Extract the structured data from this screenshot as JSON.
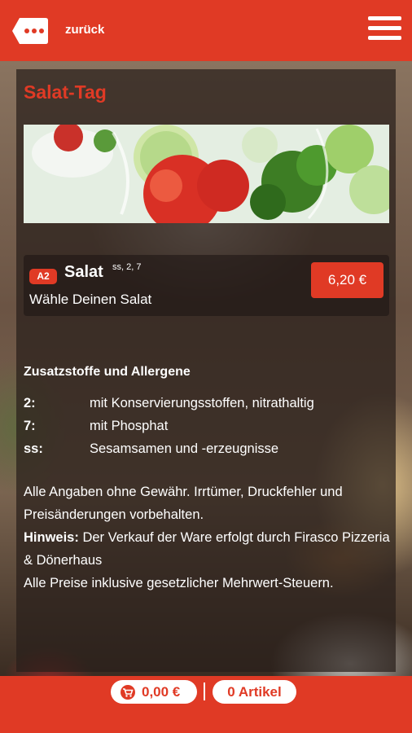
{
  "header": {
    "back_label": "zurück",
    "back_icon": "chat-bubble-back-icon",
    "menu_icon": "hamburger-menu-icon"
  },
  "section": {
    "title": "Salat-Tag"
  },
  "product": {
    "badge": "A2",
    "name": "Salat",
    "additives": "ss, 2, 7",
    "description": "Wähle Deinen Salat",
    "price": "6,20 €"
  },
  "allergens": {
    "title": "Zusatzstoffe und Allergene",
    "items": [
      {
        "code": "2:",
        "text": "mit Konservierungsstoffen, nitrathaltig"
      },
      {
        "code": "7:",
        "text": "mit Phosphat"
      },
      {
        "code": "ss:",
        "text": "Sesamsamen und -erzeugnisse"
      }
    ]
  },
  "notes": {
    "disclaimer": "Alle Angaben ohne Gewähr. Irrtümer, Druckfehler und Preisänderungen vorbehalten.",
    "hint_label": "Hinweis:",
    "hint_text": " Der Verkauf der Ware erfolgt durch Firasco Pizzeria & Dönerhaus",
    "tax": "Alle Preise inklusive gesetzlicher Mehrwert-Steuern."
  },
  "footer": {
    "cart_total": "0,00 €",
    "cart_icon": "shopping-cart-icon",
    "items_count": "0 Artikel"
  },
  "colors": {
    "accent": "#e03a25",
    "panel": "#281e1a"
  }
}
